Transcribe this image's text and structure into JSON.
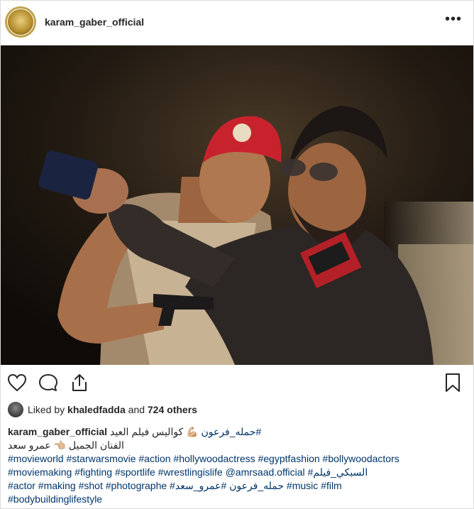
{
  "post": {
    "username": "karam_gaber_official",
    "more_icon": "ellipsis-icon",
    "liked_by": {
      "prefix": "Liked by",
      "user": "khaledfadda",
      "and": "and",
      "others": "724 others"
    },
    "caption": {
      "username": "karam_gaber_official",
      "line1_tag": "#حمله_فرعون",
      "line1_text": "💪🏼 كواليس فيلم العيد",
      "line2_text": "الفنان الجميل 👈🏼 عمرو سعد",
      "line3": "#movieworld #starwarsmovie #action #hollywoodactress #egyptfashion #bollywoodactors",
      "line4": "#moviemaking #fighting #sportlife #wrestlingislife @amrsaad.official #السبكي_فيلم",
      "line5": "#actor #making #shot #photographe #حمله_فرعون #عمرو_سعد #music #film",
      "line6": "#bodybuildinglifestyle"
    },
    "icons": {
      "like": "heart-icon",
      "comment": "comment-icon",
      "share": "share-icon",
      "save": "bookmark-icon"
    }
  }
}
